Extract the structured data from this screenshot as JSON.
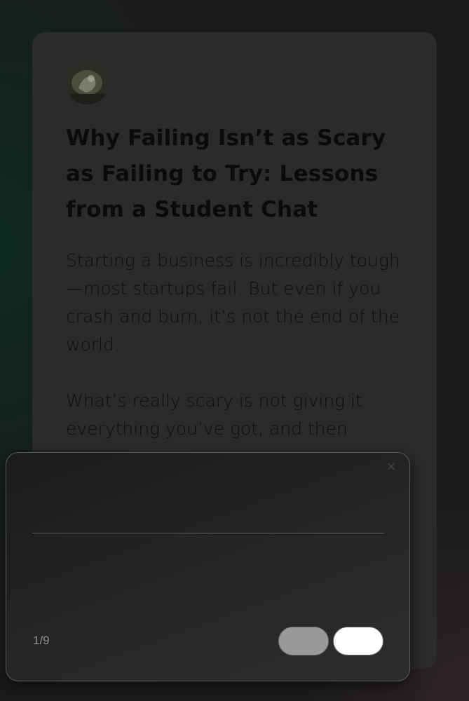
{
  "article": {
    "title": "Why Failing Isn’t as Scary as Failing to Try: Lessons from a Student Chat",
    "paragraph_1": "Starting a business is incredibly tough—most startups fail. But even if you crash and burn, it’s not the end of the world.",
    "paragraph_2": "What’s really scary is not giving it everything you’ve got, and then"
  },
  "tour_popup": {
    "close_icon": "×",
    "step_counter": "1/9",
    "prev_label": "",
    "next_label": ""
  }
}
